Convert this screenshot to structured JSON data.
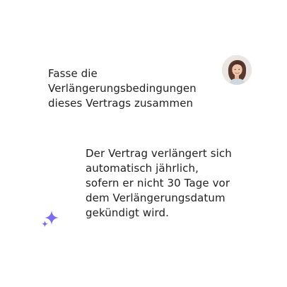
{
  "conversation": {
    "user": {
      "message": "Fasse die\nVerlängerungsbedingungen\ndieses Vertrags zusammen",
      "avatar_icon": "user-avatar-photo"
    },
    "assistant": {
      "message": "Der Vertrag verlängert sich\nautomatisch  jährlich,\nsofern er nicht 30 Tage vor\ndem Verlängerungsdatum\ngekündigt wird.",
      "icon": "sparkle-icon",
      "icon_color": "#7B6CF0"
    }
  }
}
